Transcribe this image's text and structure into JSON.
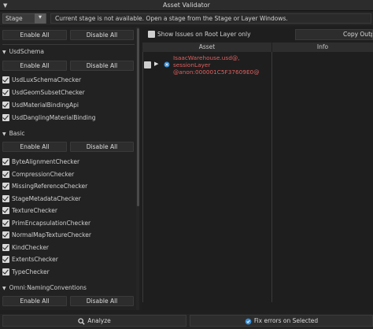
{
  "window": {
    "title": "Asset Validator"
  },
  "stage": {
    "selected": "Stage",
    "message": "Current stage is not available. Open a stage from the Stage or Layer Windows."
  },
  "left": {
    "enable_all": "Enable All",
    "disable_all": "Disable All",
    "groups": [
      {
        "name": "UsdSchema",
        "checkers": [
          "UsdLuxSchemaChecker",
          "UsdGeomSubsetChecker",
          "UsdMaterialBindingApi",
          "UsdDanglingMaterialBinding"
        ]
      },
      {
        "name": "Basic",
        "checkers": [
          "ByteAlignmentChecker",
          "CompressionChecker",
          "MissingReferenceChecker",
          "StageMetadataChecker",
          "TextureChecker",
          "PrimEncapsulationChecker",
          "NormalMapTextureChecker",
          "KindChecker",
          "ExtentsChecker",
          "TypeChecker"
        ]
      },
      {
        "name": "Omni:NamingConventions",
        "checkers": []
      }
    ]
  },
  "right": {
    "show_issues_label": "Show Issues on Root Layer only",
    "copy_output_label": "Copy Output",
    "columns": [
      "Asset",
      "Info"
    ],
    "rows": [
      {
        "asset_lines": [
          "IsaacWarehouse.usd@,",
          "sessionLayer",
          "@anon:000001C5F37609E0@"
        ]
      }
    ]
  },
  "bottom": {
    "analyze_label": "Analyze",
    "fix_label": "Fix errors on Selected"
  },
  "colors": {
    "error_text": "#e06060",
    "background": "#1f1f1f",
    "button": "#2d2d2d"
  }
}
